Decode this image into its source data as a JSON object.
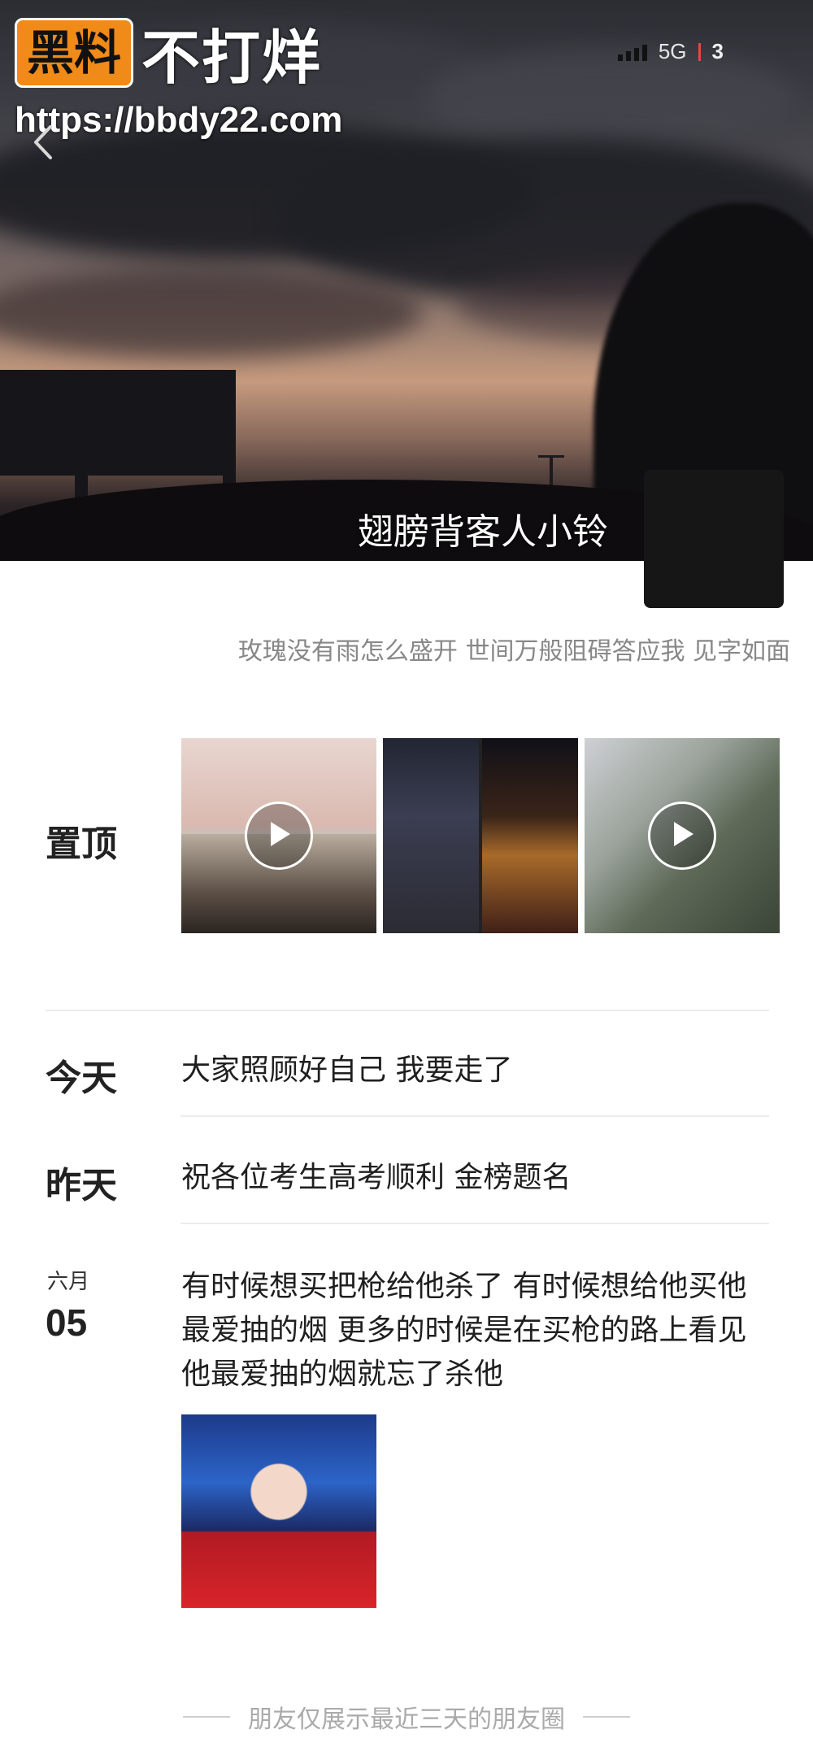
{
  "watermark": {
    "badge": "黑料",
    "text": "不打烊",
    "url": "https://bbdy22.com"
  },
  "status_bar": {
    "network": "5G",
    "battery": "3"
  },
  "profile": {
    "username": "翅膀背客人小铃",
    "signature": "玫瑰没有雨怎么盛开 世间万般阻碍答应我 见字如面"
  },
  "pinned": {
    "label": "置顶"
  },
  "posts": [
    {
      "date_label": "今天",
      "text": "大家照顾好自己 我要走了"
    },
    {
      "date_label": "昨天",
      "text": "祝各位考生高考顺利 金榜题名"
    },
    {
      "month": "六月",
      "day": "05",
      "text": "有时候想买把枪给他杀了 有时候想给他买他最爱抽的烟 更多的时候是在买枪的路上看见他最爱抽的烟就忘了杀他"
    }
  ],
  "footer": {
    "text": "朋友仅展示最近三天的朋友圈"
  },
  "icons": [
    "back-arrow-icon",
    "signal-icon",
    "play-icon"
  ]
}
